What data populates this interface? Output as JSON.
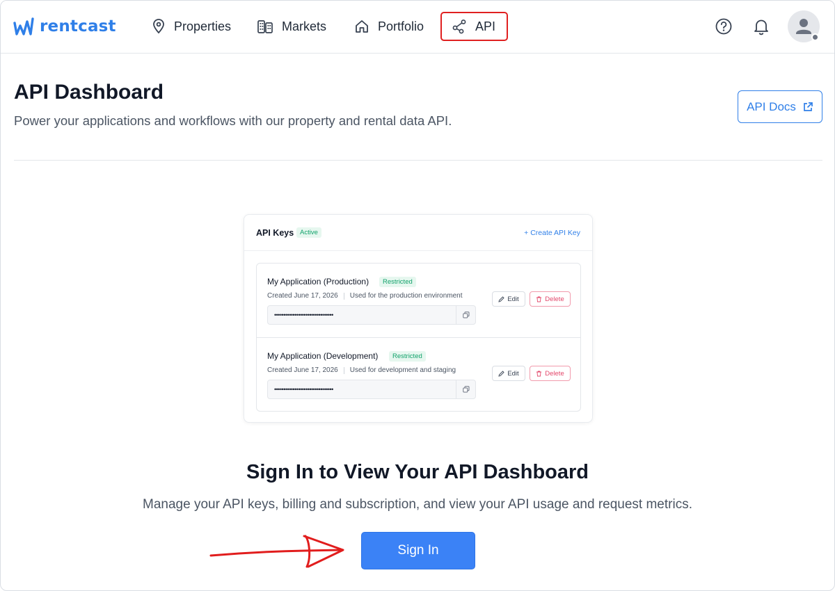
{
  "brand": {
    "name": "rentcast",
    "color": "#2f7fe8"
  },
  "nav": {
    "items": [
      {
        "label": "Properties",
        "icon": "map-pin-icon"
      },
      {
        "label": "Markets",
        "icon": "buildings-icon"
      },
      {
        "label": "Portfolio",
        "icon": "home-icon"
      },
      {
        "label": "API",
        "icon": "share-nodes-icon",
        "active": true
      }
    ]
  },
  "header_icons": [
    "help-circle-icon",
    "bell-icon",
    "user-avatar-icon"
  ],
  "page": {
    "title": "API Dashboard",
    "subtitle": "Power your applications and workflows with our property and rental data API.",
    "docs_button": "API Docs"
  },
  "preview": {
    "title": "API Keys",
    "status": "Active",
    "create_label": "+ Create API Key",
    "keys": [
      {
        "name": "My Application (Production)",
        "badge": "Restricted",
        "created": "Created June 17, 2026",
        "description": "Used for the production environment",
        "masked_key": "••••••••••••••••••••••••••••••••",
        "edit_label": "Edit",
        "delete_label": "Delete"
      },
      {
        "name": "My Application (Development)",
        "badge": "Restricted",
        "created": "Created June 17, 2026",
        "description": "Used for development and staging",
        "masked_key": "••••••••••••••••••••••••••••••••",
        "edit_label": "Edit",
        "delete_label": "Delete"
      }
    ]
  },
  "signin": {
    "title": "Sign In to View Your API Dashboard",
    "subtitle": "Manage your API keys, billing and subscription, and view your API usage and request metrics.",
    "button": "Sign In"
  },
  "colors": {
    "accent": "#3b82f6",
    "highlight_box": "#e02020",
    "success": "#12a26b",
    "danger": "#e3486b"
  }
}
